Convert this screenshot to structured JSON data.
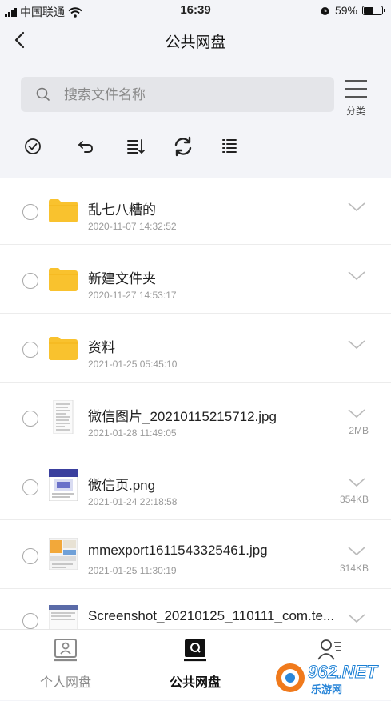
{
  "status_bar": {
    "carrier": "中国联通",
    "time": "16:39",
    "battery_percent": "59%",
    "battery_level": 0.59
  },
  "header": {
    "title": "公共网盘",
    "back_icon": "back-arrow-icon"
  },
  "search": {
    "placeholder": "搜索文件名称"
  },
  "category": {
    "label": "分类",
    "icon": "menu-lines-icon"
  },
  "toolbar": {
    "tools": [
      "select-all-icon",
      "undo-icon",
      "sort-icon",
      "refresh-icon",
      "list-view-icon"
    ]
  },
  "files": [
    {
      "name": "乱七八糟的",
      "date": "2020-11-07 14:32:52",
      "size": "",
      "type": "folder"
    },
    {
      "name": "新建文件夹",
      "date": "2020-11-27 14:53:17",
      "size": "",
      "type": "folder"
    },
    {
      "name": "资料",
      "date": "2021-01-25 05:45:10",
      "size": "",
      "type": "folder"
    },
    {
      "name": "微信图片_20210115215712.jpg",
      "date": "2021-01-28 11:49:05",
      "size": "2MB",
      "type": "image"
    },
    {
      "name": "微信页.png",
      "date": "2021-01-24 22:18:58",
      "size": "354KB",
      "type": "image"
    },
    {
      "name": "mmexport1611543325461.jpg",
      "date": "2021-01-25 11:30:19",
      "size": "314KB",
      "type": "image"
    },
    {
      "name": "Screenshot_20210125_110111_com.te...",
      "date": "",
      "size": "",
      "type": "image"
    }
  ],
  "tabs": [
    {
      "label": "个人网盘",
      "active": false,
      "icon": "personal-disk-icon"
    },
    {
      "label": "公共网盘",
      "active": true,
      "icon": "public-disk-icon"
    },
    {
      "label": "",
      "active": false,
      "icon": "contacts-icon"
    }
  ],
  "watermark": {
    "number": "962",
    "net": ".NET",
    "text": "乐游网"
  },
  "colors": {
    "folder": "#f9c22e",
    "active_tab": "#111111",
    "inactive_tab": "#8a8a8a",
    "background": "#f3f4f8"
  }
}
